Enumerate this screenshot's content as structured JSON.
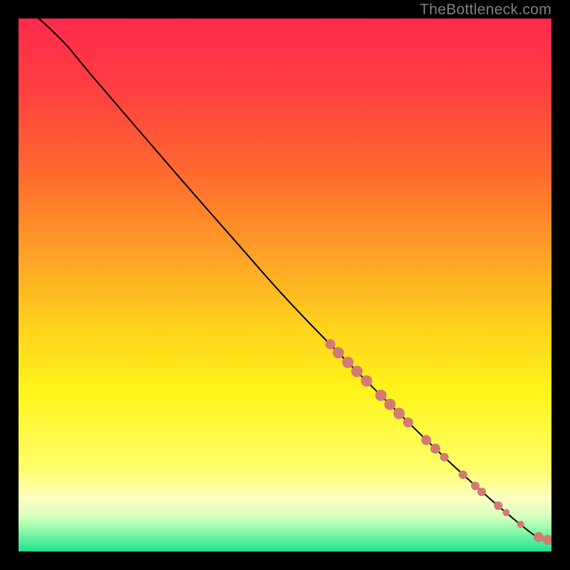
{
  "watermark": "TheBottleneck.com",
  "colors": {
    "background": "#000000",
    "watermark_text": "#808080",
    "gradient_stops": [
      {
        "offset": 0.0,
        "color": "#ff2a4d"
      },
      {
        "offset": 0.14,
        "color": "#ff4040"
      },
      {
        "offset": 0.3,
        "color": "#ff6d2e"
      },
      {
        "offset": 0.46,
        "color": "#ffa726"
      },
      {
        "offset": 0.58,
        "color": "#ffd21c"
      },
      {
        "offset": 0.7,
        "color": "#fff41a"
      },
      {
        "offset": 0.845,
        "color": "#ffff6a"
      },
      {
        "offset": 0.9,
        "color": "#ffffc4"
      },
      {
        "offset": 0.935,
        "color": "#d4ffbe"
      },
      {
        "offset": 0.962,
        "color": "#8cf7a8"
      },
      {
        "offset": 1.0,
        "color": "#1de290"
      }
    ],
    "curve": "#000000",
    "marker": "#d37a75"
  },
  "chart_data": {
    "type": "line",
    "title": "",
    "xlabel": "",
    "ylabel": "",
    "xlim": [
      0,
      100
    ],
    "ylim": [
      0,
      100
    ],
    "grid": false,
    "curve": [
      {
        "x": 3.8,
        "y": 100.0
      },
      {
        "x": 6.0,
        "y": 98.0
      },
      {
        "x": 9.0,
        "y": 95.0
      },
      {
        "x": 11.5,
        "y": 92.0
      },
      {
        "x": 14.0,
        "y": 89.0
      },
      {
        "x": 20.0,
        "y": 82.0
      },
      {
        "x": 30.0,
        "y": 70.4
      },
      {
        "x": 40.0,
        "y": 59.0
      },
      {
        "x": 50.0,
        "y": 47.7
      },
      {
        "x": 60.0,
        "y": 37.3
      },
      {
        "x": 70.0,
        "y": 27.3
      },
      {
        "x": 80.0,
        "y": 17.6
      },
      {
        "x": 88.0,
        "y": 10.3
      },
      {
        "x": 94.0,
        "y": 5.2
      },
      {
        "x": 97.0,
        "y": 2.9
      },
      {
        "x": 99.3,
        "y": 1.8
      }
    ],
    "markers": [
      {
        "x": 58.5,
        "y": 38.9,
        "r": 7
      },
      {
        "x": 60.0,
        "y": 37.3,
        "r": 8
      },
      {
        "x": 61.8,
        "y": 35.5,
        "r": 8
      },
      {
        "x": 63.5,
        "y": 33.8,
        "r": 8
      },
      {
        "x": 65.3,
        "y": 32.0,
        "r": 8
      },
      {
        "x": 68.0,
        "y": 29.3,
        "r": 8
      },
      {
        "x": 69.7,
        "y": 27.6,
        "r": 8
      },
      {
        "x": 71.4,
        "y": 25.9,
        "r": 8
      },
      {
        "x": 73.1,
        "y": 24.2,
        "r": 7
      },
      {
        "x": 76.5,
        "y": 20.9,
        "r": 7
      },
      {
        "x": 78.2,
        "y": 19.3,
        "r": 7
      },
      {
        "x": 79.9,
        "y": 17.7,
        "r": 6
      },
      {
        "x": 83.4,
        "y": 14.4,
        "r": 6
      },
      {
        "x": 85.7,
        "y": 12.3,
        "r": 6
      },
      {
        "x": 86.9,
        "y": 11.2,
        "r": 6
      },
      {
        "x": 90.0,
        "y": 8.6,
        "r": 6
      },
      {
        "x": 91.5,
        "y": 7.3,
        "r": 5
      },
      {
        "x": 94.2,
        "y": 5.1,
        "r": 5
      },
      {
        "x": 97.6,
        "y": 2.7,
        "r": 7
      },
      {
        "x": 99.3,
        "y": 2.2,
        "r": 7
      }
    ]
  }
}
